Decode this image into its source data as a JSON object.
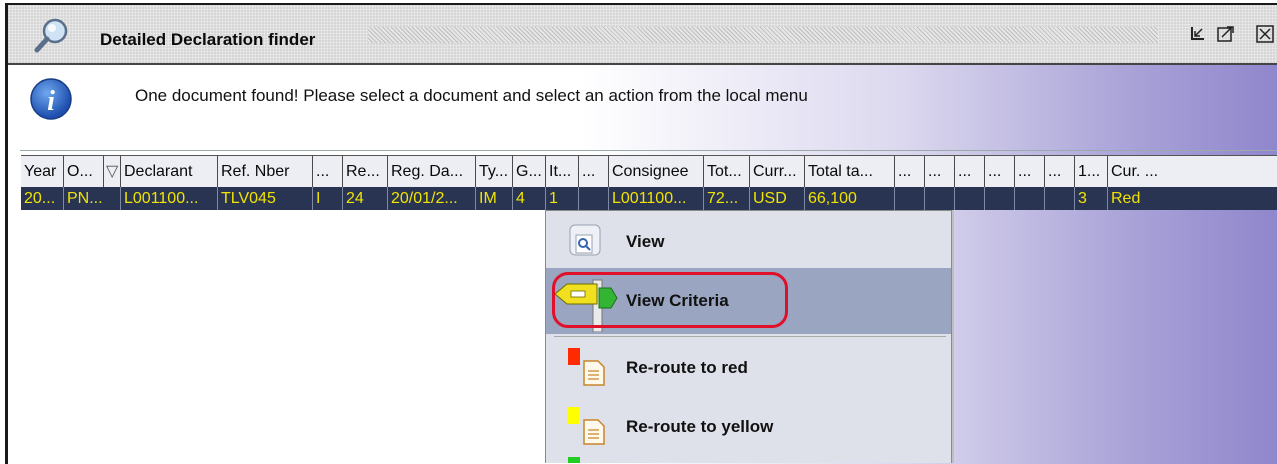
{
  "window": {
    "title": "Detailed Declaration finder",
    "icon": "magnifier-icon",
    "buttons": [
      "minimize-icon",
      "maximize-icon",
      "close-icon"
    ]
  },
  "info": {
    "icon": "info-icon",
    "message": "One document found! Please select a document and select an action from the local menu"
  },
  "table": {
    "columns": [
      "Year",
      "O...",
      "Declarant",
      "Ref. Nber",
      "...",
      "Re...",
      "Reg. Da...",
      "Ty...",
      "G...",
      "It...",
      "...",
      "Consignee",
      "Tot...",
      "Curr...",
      "Total ta...",
      "...",
      "...",
      "...",
      "...",
      "...",
      "...",
      "1...",
      "Cur. ..."
    ],
    "sorted_column_marker": "▽",
    "rows": [
      [
        "20...",
        "PN...",
        "L001100...",
        "TLV045",
        "I",
        "24",
        "20/01/2...",
        "IM",
        "4",
        "1",
        "",
        "L001100...",
        "72...",
        "USD",
        "66,100",
        "",
        "",
        "",
        "",
        "",
        "",
        "3",
        "Red"
      ]
    ]
  },
  "context_menu": {
    "items": [
      {
        "label": "View",
        "icon": "view-document-icon"
      },
      {
        "label": "View Criteria",
        "icon": "signpost-icon",
        "selected": true
      },
      {
        "label": "Re-route to red",
        "icon": "document-icon",
        "color": "#ff2a00"
      },
      {
        "label": "Re-route to yellow",
        "icon": "document-icon",
        "color": "#ffff00"
      }
    ]
  },
  "colors": {
    "selected_row_bg": "#283452",
    "selected_row_text": "#f2e400",
    "menu_selection": "#9aa6c1",
    "highlight_ring": "#e0102a"
  }
}
